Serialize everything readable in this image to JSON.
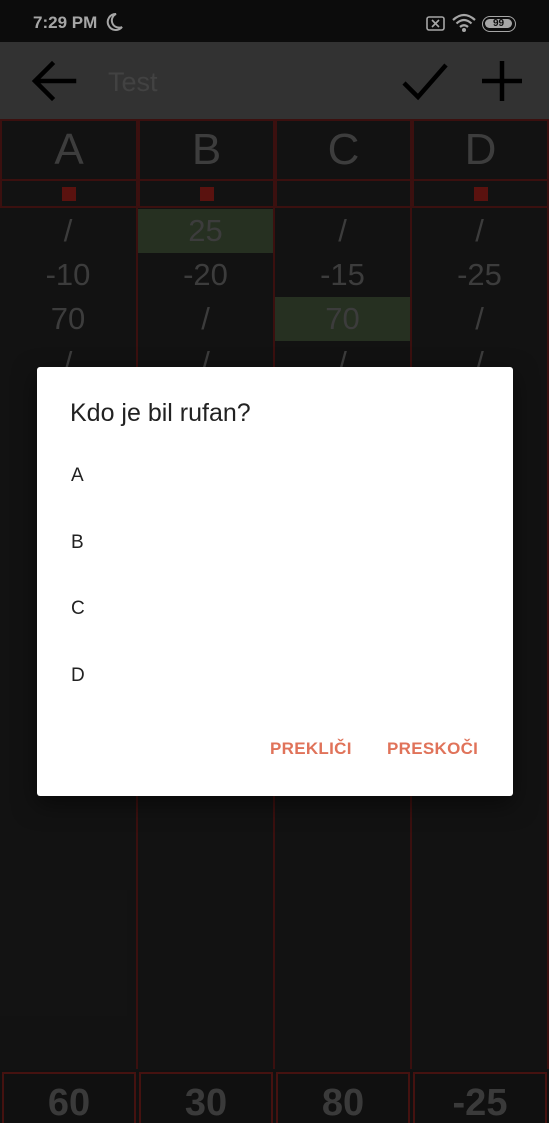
{
  "status_bar": {
    "time": "7:29 PM",
    "icons": [
      "moon-icon",
      "sim-disabled-icon",
      "wifi-icon"
    ],
    "battery": "99"
  },
  "app_bar": {
    "title": "Test",
    "icons": [
      "arrow-back-icon",
      "check-icon",
      "plus-icon"
    ]
  },
  "score_table": {
    "columns": [
      {
        "player": "A",
        "values": [
          "/",
          "-10",
          "70",
          "/"
        ],
        "highlighted": [
          false,
          false,
          false,
          false
        ],
        "total": "60"
      },
      {
        "player": "B",
        "values": [
          "25",
          "-20",
          "/",
          "/"
        ],
        "highlighted": [
          true,
          false,
          false,
          false
        ],
        "total": "30"
      },
      {
        "player": "C",
        "values": [
          "/",
          "-15",
          "70",
          "/"
        ],
        "highlighted": [
          false,
          false,
          true,
          false
        ],
        "total": "80"
      },
      {
        "player": "D",
        "values": [
          "/",
          "-25",
          "/",
          "/"
        ],
        "highlighted": [
          false,
          false,
          false,
          false
        ],
        "total": "-25"
      }
    ]
  },
  "dialog": {
    "title": "Kdo je bil rufan?",
    "options": [
      "A",
      "B",
      "C",
      "D"
    ],
    "cancel_label": "PREKLIČI",
    "skip_label": "PRESKOČI"
  },
  "colors": {
    "accent": "#e0735a",
    "grid_border": "#5b1a18",
    "marker": "#8a1d17",
    "highlight": "#3b4a33"
  }
}
